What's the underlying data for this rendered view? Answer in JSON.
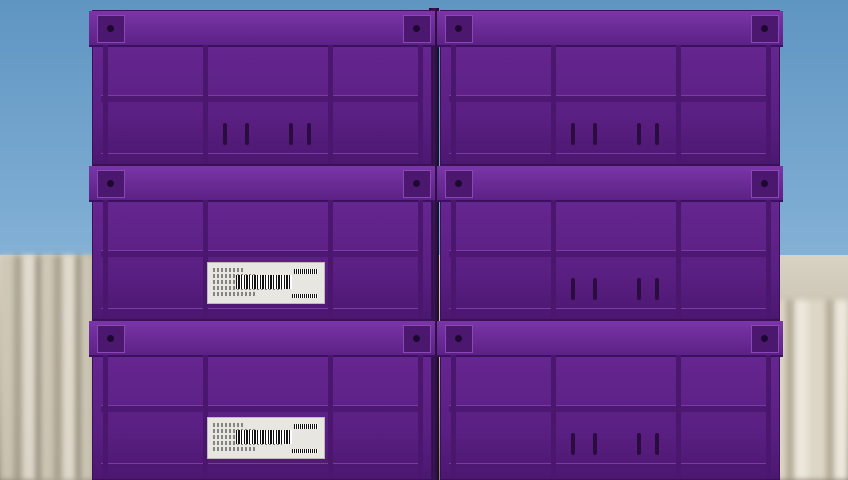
{
  "scene": {
    "subject": "stacked-crates",
    "colors": {
      "crate": "#5f2389",
      "sky": "#6fa1c9",
      "ground": "#cfc7b6",
      "label": "#e8e6e1"
    },
    "crate_columns": 2,
    "crate_rows": 3,
    "labels_visible": 2
  }
}
